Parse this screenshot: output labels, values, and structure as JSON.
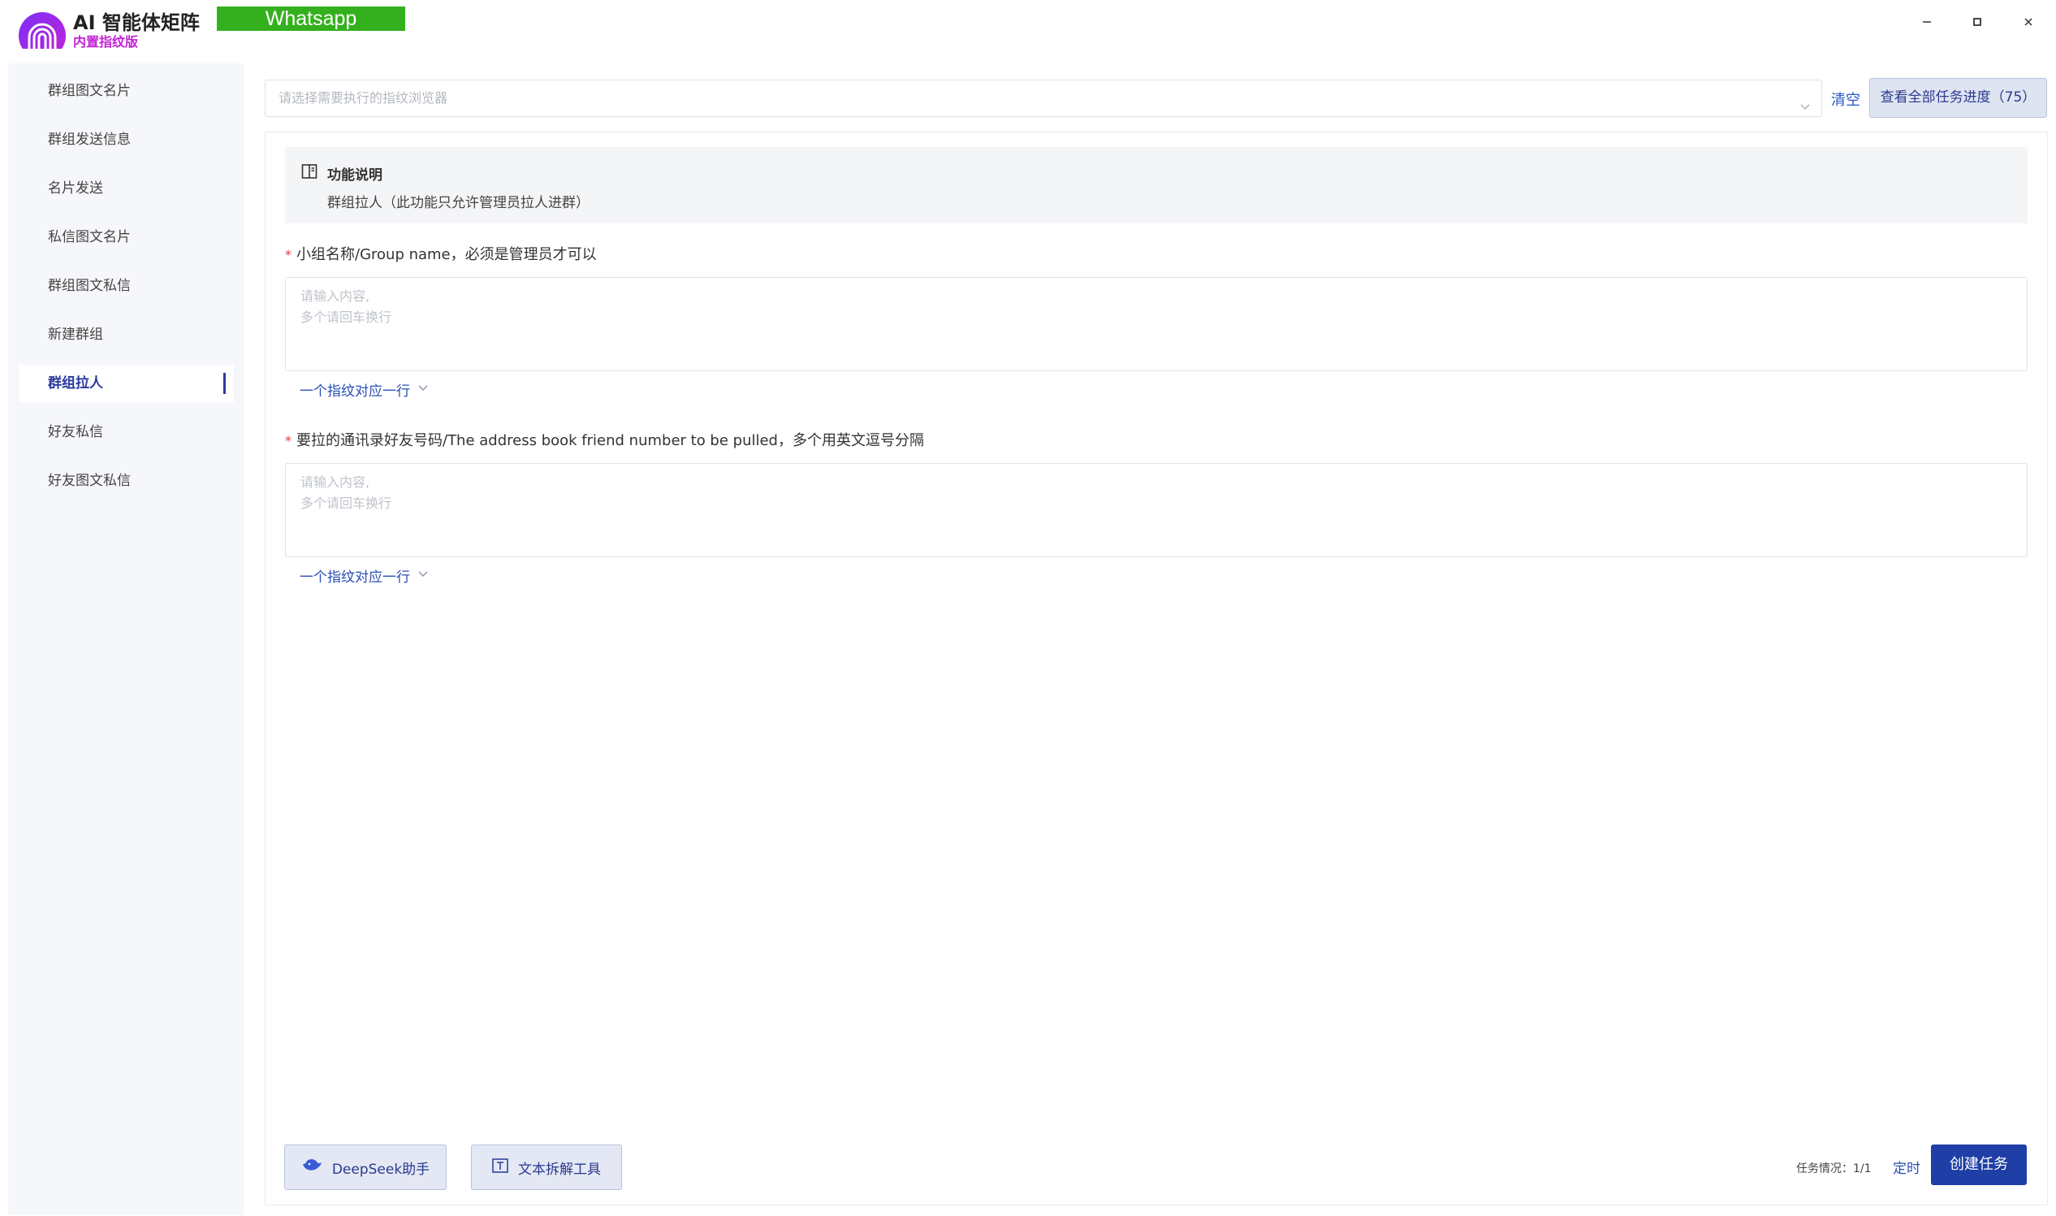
{
  "app": {
    "title": "AI 智能体矩阵",
    "subtitle": "内置指纹版",
    "platform": "Whatsapp",
    "accent_color": "#1f3fa6",
    "logo_colors": [
      "#7b2ff7",
      "#c322d6"
    ]
  },
  "window_controls": [
    "minimize-icon",
    "maximize-icon",
    "close-icon"
  ],
  "sidebar": {
    "items": [
      {
        "label": "群组图文名片",
        "active": false
      },
      {
        "label": "群组发送信息",
        "active": false
      },
      {
        "label": "名片发送",
        "active": false
      },
      {
        "label": "私信图文名片",
        "active": false
      },
      {
        "label": "群组图文私信",
        "active": false
      },
      {
        "label": "新建群组",
        "active": false
      },
      {
        "label": "群组拉人",
        "active": true
      },
      {
        "label": "好友私信",
        "active": false
      },
      {
        "label": "好友图文私信",
        "active": false
      }
    ]
  },
  "top": {
    "browser_select_placeholder": "请选择需要执行的指纹浏览器",
    "clear_label": "清空",
    "progress_button_label": "查看全部任务进度（75）"
  },
  "info": {
    "title": "功能说明",
    "text": "群组拉人（此功能只允许管理员拉人进群）"
  },
  "fields": [
    {
      "required_mark": "*",
      "label": "小组名称/Group name，必须是管理员才可以",
      "placeholder_lines": [
        "请输入内容,",
        "多个请回车换行"
      ],
      "expand_label": "一个指纹对应一行"
    },
    {
      "required_mark": "*",
      "label": "要拉的通讯录好友号码/The address book friend number to be pulled，多个用英文逗号分隔",
      "placeholder_lines": [
        "请输入内容,",
        "多个请回车换行"
      ],
      "expand_label": "一个指纹对应一行"
    }
  ],
  "footer": {
    "deepseek_label": "DeepSeek助手",
    "split_tool_label": "文本拆解工具",
    "task_status": "任务情况：1/1",
    "schedule_label": "定时",
    "create_label": "创建任务"
  }
}
